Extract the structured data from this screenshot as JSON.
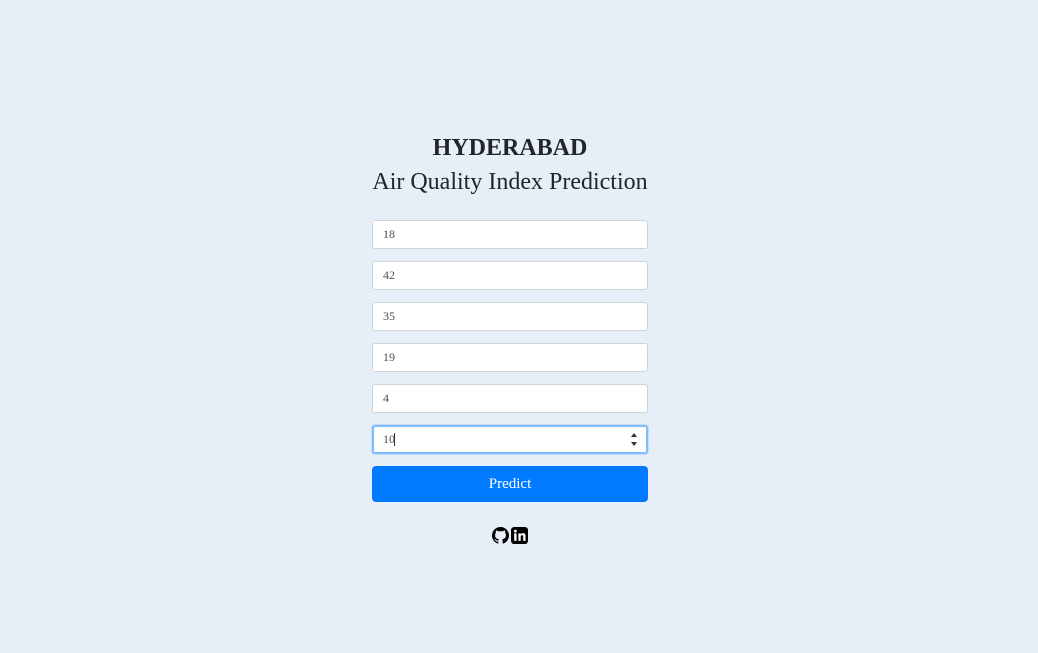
{
  "header": {
    "city": "HYDERABAD",
    "subtitle": "Air Quality Index Prediction"
  },
  "form": {
    "fields": [
      {
        "value": "18"
      },
      {
        "value": "42"
      },
      {
        "value": "35"
      },
      {
        "value": "19"
      },
      {
        "value": "4"
      },
      {
        "value": "10"
      }
    ],
    "submit_label": "Predict"
  },
  "social": {
    "icons": [
      "github-icon",
      "linkedin-icon"
    ]
  },
  "colors": {
    "background": "#e6eef8",
    "accent": "#007bff",
    "focus_border": "#80bdff"
  }
}
